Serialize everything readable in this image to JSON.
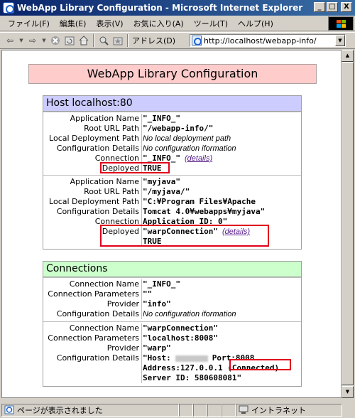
{
  "window": {
    "title": "WebApp Library Configuration - Microsoft Internet Explorer",
    "minimize": "_",
    "maximize": "□",
    "close": "X"
  },
  "menu": [
    "ファイル(F)",
    "編集(E)",
    "表示(V)",
    "お気に入り(A)",
    "ツール(T)",
    "ヘルプ(H)"
  ],
  "toolbar": {
    "address_label": "アドレス(D)",
    "address_value": "http://localhost/webapp-info/"
  },
  "page": {
    "title": "WebApp Library Configuration"
  },
  "host_section": {
    "header": "Host localhost:80",
    "apps": [
      {
        "labels": [
          "Application Name",
          "Root URL Path",
          "Local Deployment Path",
          "Configuration Details",
          "Connection",
          "Deployed"
        ],
        "name": "\"_INFO_\"",
        "root": "\"/webapp-info/\"",
        "path": "No local deployment path",
        "config": "No configuration iformation",
        "connection": "\"_INFO_\"",
        "details_link": "(details)",
        "deployed": "TRUE"
      },
      {
        "labels": [
          "Application Name",
          "Root URL Path",
          "Local Deployment Path",
          "Configuration Details",
          "Connection",
          "Deployed"
        ],
        "name": "\"myjava\"",
        "root": "\"/myjava/\"",
        "path": "\"C:¥Program Files¥Apache",
        "config": "Tomcat 4.0¥webapps¥myjava\"",
        "connection": "Application ID: 0\"",
        "deployed_conn": "\"warpConnection\"",
        "details_link": "(details)",
        "deployed": "TRUE"
      }
    ]
  },
  "connections_section": {
    "header": "Connections",
    "items": [
      {
        "labels": [
          "Connection Name",
          "Connection Parameters",
          "Provider",
          "Configuration Details"
        ],
        "name": "\"_INFO_\"",
        "params": "\"\"",
        "provider": "\"info\"",
        "config": "No configuration iformation"
      },
      {
        "labels": [
          "Connection Name",
          "Connection Parameters",
          "Provider",
          "Configuration Details"
        ],
        "name": "\"warpConnection\"",
        "params": "\"localhost:8008\"",
        "provider": "\"warp\"",
        "config_lines": [
          "\"Host:",
          "Port:8008",
          "Address:127.0.0.1",
          "(Connected)",
          "Server ID: 580608081\""
        ]
      }
    ]
  },
  "status": {
    "text": "ページが表示されました",
    "zone": "イントラネット"
  }
}
